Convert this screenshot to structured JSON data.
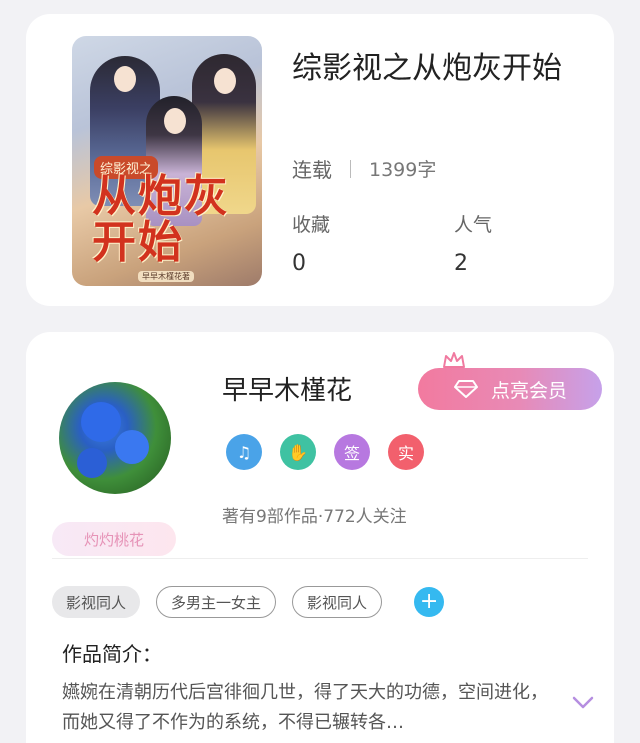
{
  "book": {
    "title": "综影视之从炮灰开始",
    "status": "连载",
    "word_count": "1399字",
    "stats": [
      {
        "label": "收藏",
        "value": "0"
      },
      {
        "label": "人气",
        "value": "2"
      }
    ],
    "cover": {
      "tag": "综影视之",
      "title_text": "从炮灰开始",
      "author_text": "早早木槿花著"
    }
  },
  "author": {
    "name": "早早木槿花",
    "vip_button": "点亮会员",
    "fan_badge": "灼灼桃花",
    "badges": [
      {
        "icon": "music-medal-icon",
        "color": "#4aa3e8"
      },
      {
        "icon": "handshake-medal-icon",
        "color": "#3fc2a2"
      },
      {
        "icon": "sign-badge",
        "text": "签",
        "color": "#b778e0"
      },
      {
        "icon": "verified-badge",
        "text": "实",
        "color": "#f2606d"
      }
    ],
    "meta": "著有9部作品·772人关注"
  },
  "tags": {
    "items": [
      "影视同人",
      "多男主一女主",
      "影视同人"
    ],
    "add_label": "+"
  },
  "intro": {
    "heading": "作品简介：",
    "text": "嬿婉在清朝历代后宫徘徊几世，得了天大的功德，空间进化，而她又得了不作为的系统，不得已辗转各…"
  },
  "colors": {
    "accent_blue": "#35b9f0",
    "vip_start": "#f27a9f",
    "vip_end": "#c6a1ea"
  }
}
